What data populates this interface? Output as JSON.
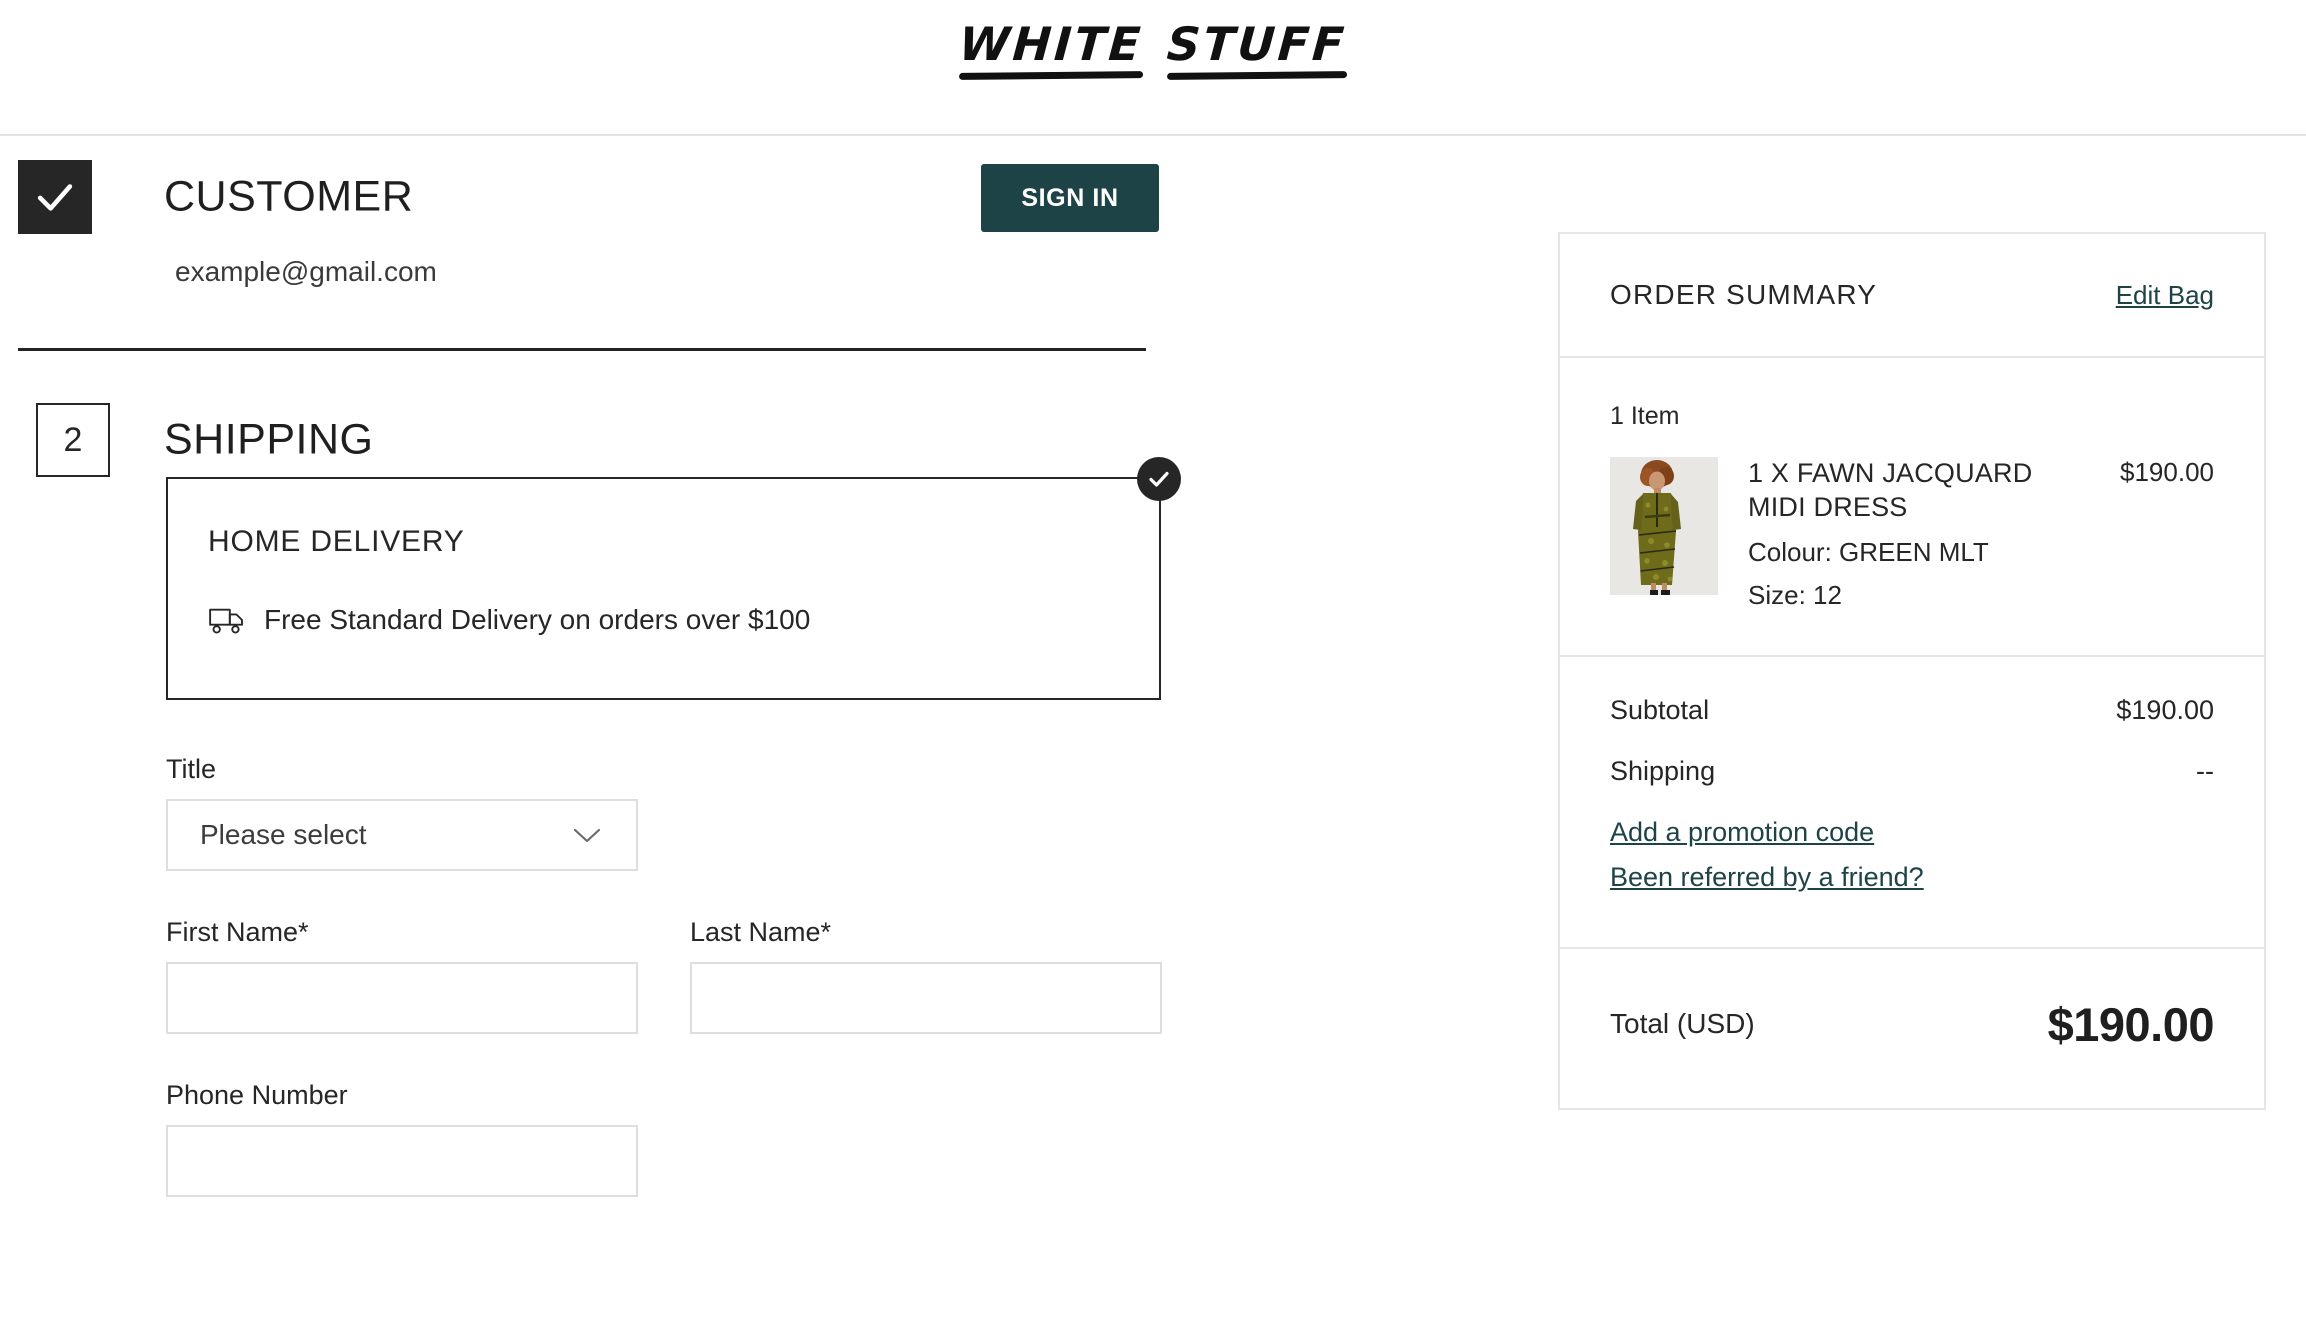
{
  "brand": {
    "word1": "WHITE",
    "word2": "STUFF",
    "accent_color": "#1e4347",
    "ink_color": "#262626"
  },
  "checkout": {
    "customer": {
      "step_state": "complete",
      "step_icon": "check-icon",
      "title": "CUSTOMER",
      "email": "example@gmail.com",
      "sign_in_label": "SIGN IN"
    },
    "shipping": {
      "step_number": "2",
      "title": "SHIPPING",
      "delivery_option": {
        "name": "HOME DELIVERY",
        "selected": true,
        "badge_icon": "check-circle-icon",
        "promo_icon": "truck-icon",
        "promo_text": "Free Standard Delivery on orders over $100"
      },
      "form": {
        "title_label": "Title",
        "title_value": "Please select",
        "title_chevron_icon": "chevron-down-icon",
        "first_name_label": "First Name*",
        "first_name_value": "",
        "first_name_placeholder": "",
        "last_name_label": "Last Name*",
        "last_name_value": "",
        "last_name_placeholder": "",
        "phone_label": "Phone Number",
        "phone_value": "",
        "phone_placeholder": ""
      }
    }
  },
  "order_summary": {
    "heading": "ORDER SUMMARY",
    "edit_bag_label": "Edit Bag",
    "item_count_label": "1 Item",
    "items": [
      {
        "name": "1 X FAWN JACQUARD MIDI DRESS",
        "colour": "Colour: GREEN MLT",
        "size": "Size: 12",
        "price": "$190.00",
        "thumb_alt": "model-in-olive-jacquard-midi-dress"
      }
    ],
    "subtotal_label": "Subtotal",
    "subtotal_value": "$190.00",
    "shipping_label": "Shipping",
    "shipping_value": "--",
    "promotion_link": "Add a promotion code",
    "referral_link": "Been referred by a friend?",
    "total_label": "Total (USD)",
    "total_value": "$190.00"
  }
}
